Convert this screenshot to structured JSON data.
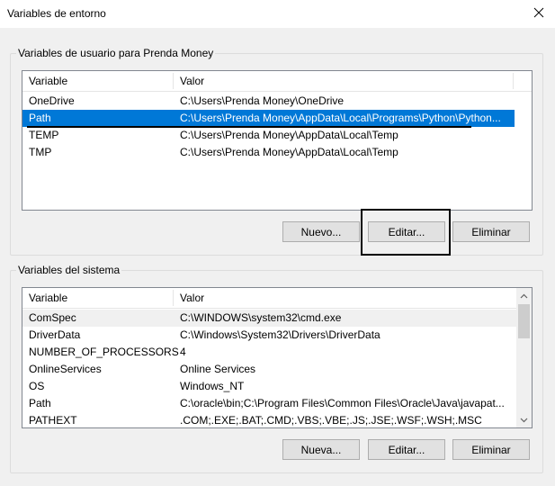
{
  "window": {
    "title": "Variables de entorno",
    "close_icon": "close-icon"
  },
  "user_vars": {
    "group_label": "Variables de usuario para Prenda Money",
    "columns": [
      "Variable",
      "Valor"
    ],
    "rows": [
      {
        "variable": "OneDrive",
        "valor": "C:\\Users\\Prenda Money\\OneDrive"
      },
      {
        "variable": "Path",
        "valor": "C:\\Users\\Prenda Money\\AppData\\Local\\Programs\\Python\\Python...",
        "selected": true
      },
      {
        "variable": "TEMP",
        "valor": "C:\\Users\\Prenda Money\\AppData\\Local\\Temp"
      },
      {
        "variable": "TMP",
        "valor": "C:\\Users\\Prenda Money\\AppData\\Local\\Temp"
      }
    ],
    "buttons": {
      "new": "Nuevo...",
      "edit": "Editar...",
      "delete": "Eliminar"
    }
  },
  "system_vars": {
    "group_label": "Variables del sistema",
    "columns": [
      "Variable",
      "Valor"
    ],
    "rows": [
      {
        "variable": "ComSpec",
        "valor": "C:\\WINDOWS\\system32\\cmd.exe"
      },
      {
        "variable": "DriverData",
        "valor": "C:\\Windows\\System32\\Drivers\\DriverData"
      },
      {
        "variable": "NUMBER_OF_PROCESSORS",
        "valor": "4"
      },
      {
        "variable": "OnlineServices",
        "valor": "Online Services"
      },
      {
        "variable": "OS",
        "valor": "Windows_NT"
      },
      {
        "variable": "Path",
        "valor": "C:\\oracle\\bin;C:\\Program Files\\Common Files\\Oracle\\Java\\javapat..."
      },
      {
        "variable": "PATHEXT",
        "valor": ".COM;.EXE;.BAT;.CMD;.VBS;.VBE;.JS;.JSE;.WSF;.WSH;.MSC"
      }
    ],
    "buttons": {
      "new": "Nueva...",
      "edit": "Editar...",
      "delete": "Eliminar"
    }
  },
  "colors": {
    "selection": "#0078d7",
    "dialog_bg": "#f0f0f0",
    "annotation": "#000000"
  }
}
